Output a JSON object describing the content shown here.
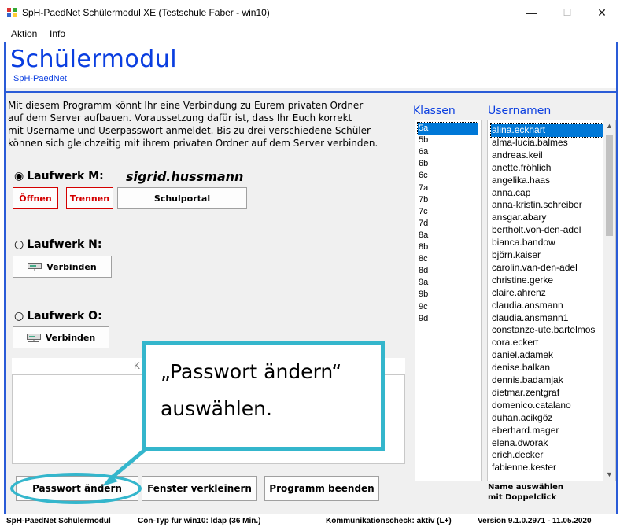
{
  "window": {
    "title": "SpH-PaedNet Schülermodul XE (Testschule Faber - win10)",
    "minimize": "—",
    "maximize": "☐",
    "close": "✕"
  },
  "menu": [
    "Aktion",
    "Info"
  ],
  "header": {
    "title": "Schülermodul",
    "subtitle": "SpH-PaedNet"
  },
  "intro_lines": [
    "Mit diesem Programm könnt Ihr eine Verbindung zu Eurem privaten Ordner",
    "auf dem Server aufbauen. Voraussetzung dafür ist, dass Ihr Euch korrekt",
    "mit Username und Userpasswort anmeldet. Bis zu drei verschiedene Schüler",
    "können sich gleichzeitig mit ihrem privaten Ordner auf dem Server verbinden."
  ],
  "drives": {
    "m": {
      "label": "Laufwerk M:",
      "selected": true,
      "user": "sigrid.hussmann",
      "open": "Öffnen",
      "disconnect": "Trennen",
      "portal": "Schulportal"
    },
    "n": {
      "label": "Laufwerk N:",
      "selected": false,
      "connect": "Verbinden"
    },
    "o": {
      "label": "Laufwerk O:",
      "selected": false,
      "connect": "Verbinden"
    }
  },
  "log": {
    "header_fragment": "K"
  },
  "classes": {
    "heading": "Klassen",
    "items": [
      "5a",
      "5b",
      "6a",
      "6b",
      "6c",
      "7a",
      "7b",
      "7c",
      "7d",
      "8a",
      "8b",
      "8c",
      "8d",
      "9a",
      "9b",
      "9c",
      "9d"
    ],
    "selected": "5a"
  },
  "users": {
    "heading": "Usernamen",
    "items": [
      "alina.eckhart",
      "alma-lucia.balmes",
      "andreas.keil",
      "anette.fröhlich",
      "angelika.haas",
      "anna.cap",
      "anna-kristin.schreiber",
      "ansgar.abary",
      "bertholt.von-den-adel",
      "bianca.bandow",
      "björn.kaiser",
      "carolin.van-den-adel",
      "christine.gerke",
      "claire.ahrenz",
      "claudia.ansmann",
      "claudia.ansmann1",
      "constanze-ute.bartelmos",
      "cora.eckert",
      "daniel.adamek",
      "denise.balkan",
      "dennis.badamjak",
      "dietmar.zentgraf",
      "domenico.catalano",
      "duhan.acikgöz",
      "eberhard.mager",
      "elena.dworak",
      "erich.decker",
      "fabienne.kester"
    ],
    "selected": "alina.eckhart",
    "hint_line1": "Name auswählen",
    "hint_line2": "mit Doppelclick"
  },
  "buttons": {
    "change_password": "Passwort ändern",
    "minimize_window": "Fenster verkleinern",
    "quit": "Programm beenden"
  },
  "status": {
    "app": "SpH-PaedNet Schülermodul",
    "con_type": "Con-Typ für win10: ldap  (36 Min.)",
    "check": "Kommunikationscheck: aktiv (L+)",
    "version": "Version 9.1.0.2971 - 11.05.2020"
  },
  "callout": {
    "line1": "„Passwort ändern“",
    "line2": "auswählen."
  },
  "colors": {
    "accent": "#0a3ee0",
    "selection": "#0078d7",
    "callout": "#34b6cc",
    "danger": "#d40000"
  }
}
